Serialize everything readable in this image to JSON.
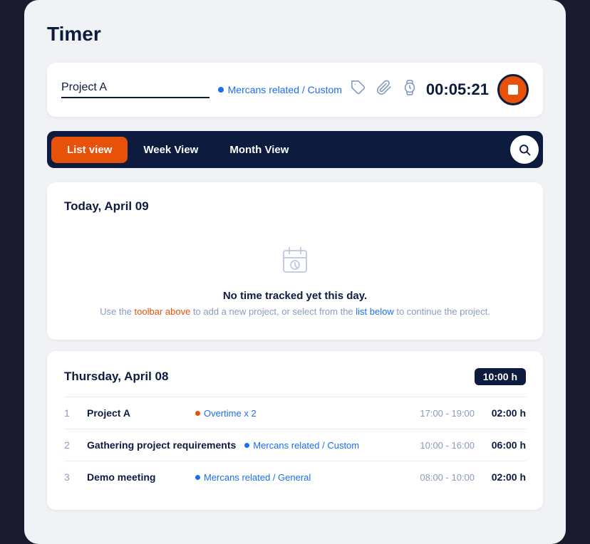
{
  "app": {
    "title": "Timer"
  },
  "timer_bar": {
    "project_input_value": "Project A",
    "project_input_placeholder": "Project A",
    "tag_text": "Mercans related / Custom",
    "time_display": "00:05:21",
    "stop_label": "Stop"
  },
  "nav": {
    "items": [
      {
        "id": "list",
        "label": "List view",
        "active": true
      },
      {
        "id": "week",
        "label": "Week View",
        "active": false
      },
      {
        "id": "month",
        "label": "Month View",
        "active": false
      }
    ]
  },
  "today_section": {
    "title": "Today, April 09",
    "empty_title": "No time tracked yet this day.",
    "empty_subtitle_part1": "Use the ",
    "empty_subtitle_link1": "toolbar above",
    "empty_subtitle_part2": " to add a new project, or select from the ",
    "empty_subtitle_link2": "list below",
    "empty_subtitle_part3": " to continue the project."
  },
  "thursday_section": {
    "title": "Thursday, April 08",
    "total": "10:00 h",
    "entries": [
      {
        "num": "1",
        "name": "Project A",
        "tag": "Overtime x 2",
        "tag_color": "orange",
        "time_range": "17:00 - 19:00",
        "duration": "02:00 h"
      },
      {
        "num": "2",
        "name": "Gathering project requirements",
        "tag": "Mercans related / Custom",
        "tag_color": "blue",
        "time_range": "10:00 - 16:00",
        "duration": "06:00 h"
      },
      {
        "num": "3",
        "name": "Demo meeting",
        "tag": "Mercans related / General",
        "tag_color": "blue",
        "time_range": "08:00 - 10:00",
        "duration": "02:00 h"
      }
    ]
  }
}
